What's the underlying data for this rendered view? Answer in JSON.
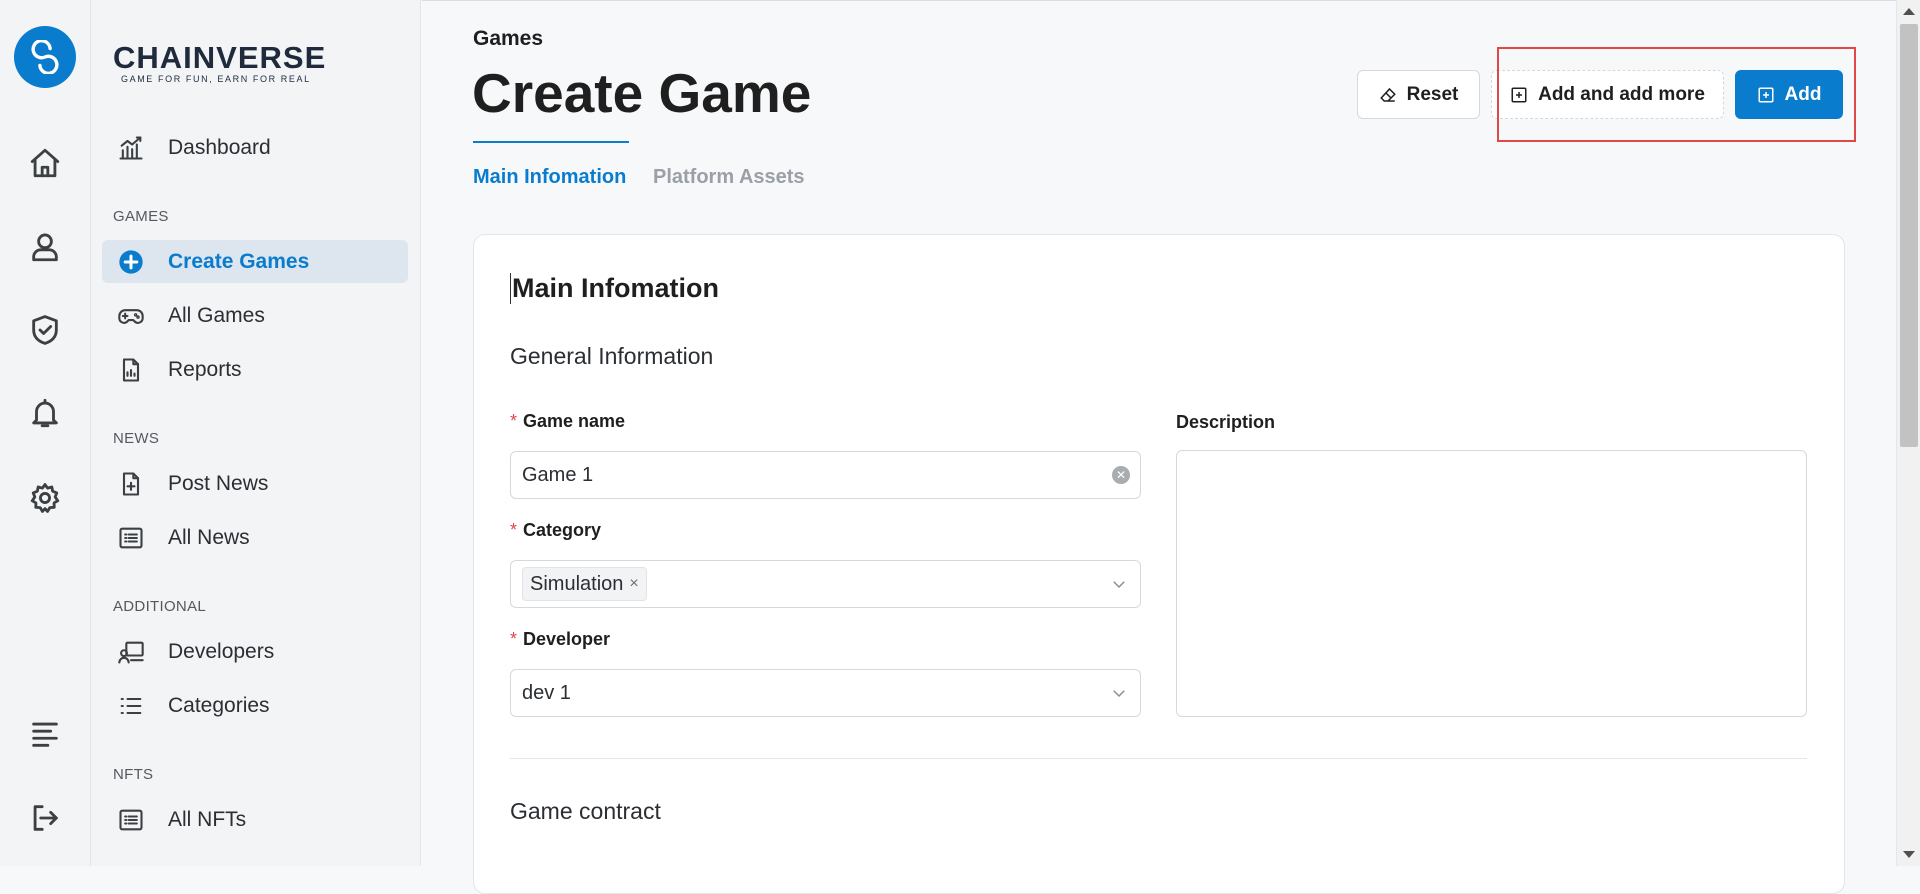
{
  "brand": {
    "name": "CHAINVERSE",
    "tagline": "GAME FOR FUN, EARN FOR REAL"
  },
  "rail": {
    "items": [
      {
        "icon": "home-icon"
      },
      {
        "icon": "user-icon"
      },
      {
        "icon": "shield-check-icon"
      },
      {
        "icon": "bell-icon"
      },
      {
        "icon": "gear-icon"
      },
      {
        "icon": "menu-icon"
      },
      {
        "icon": "logout-icon"
      }
    ]
  },
  "sidebar": {
    "dashboard": "Dashboard",
    "sections": {
      "games": "GAMES",
      "news": "NEWS",
      "additional": "ADDITIONAL",
      "nfts": "NFTS"
    },
    "items": {
      "create_games": "Create Games",
      "all_games": "All Games",
      "reports": "Reports",
      "post_news": "Post News",
      "all_news": "All News",
      "developers": "Developers",
      "categories": "Categories",
      "all_nfts": "All NFTs"
    }
  },
  "header": {
    "breadcrumb": "Games",
    "title": "Create Game",
    "reset_label": "Reset",
    "add_more_label": "Add and add more",
    "add_label": "Add"
  },
  "tabs": {
    "main": "Main Infomation",
    "assets": "Platform Assets"
  },
  "form": {
    "card_title": "Main Infomation",
    "general_title": "General Information",
    "game_name_label": "Game name",
    "game_name_value": "Game 1",
    "category_label": "Category",
    "category_chip": "Simulation",
    "developer_label": "Developer",
    "developer_value": "dev 1",
    "description_label": "Description",
    "description_value": "",
    "contract_title": "Game contract",
    "required_mark": "*"
  },
  "colors": {
    "accent": "#0a7ccd",
    "highlight": "#e04848",
    "active_bg": "#dde6ef"
  }
}
